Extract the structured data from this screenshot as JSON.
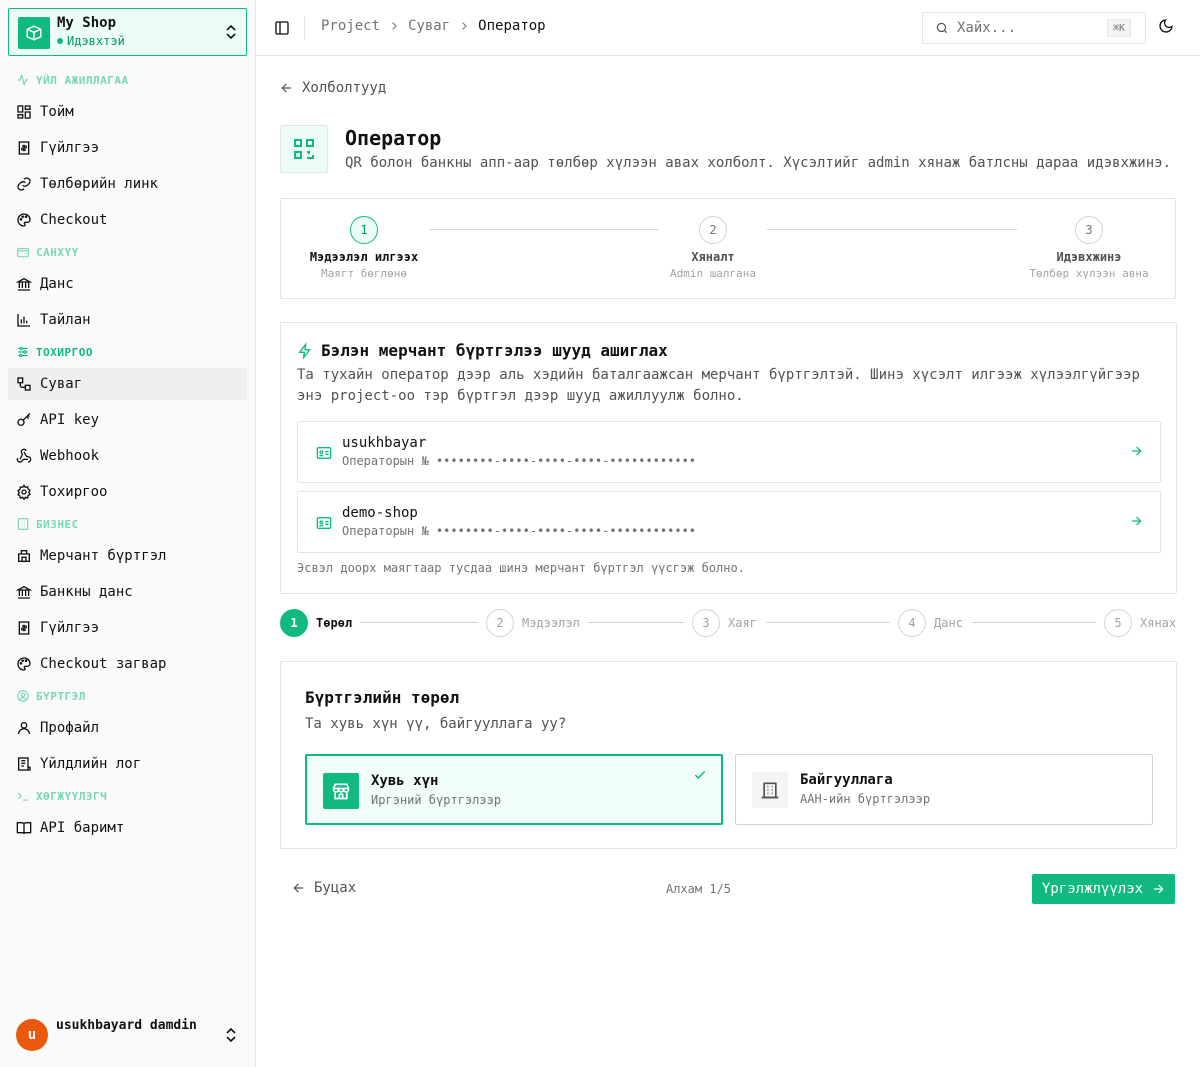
{
  "shop": {
    "name": "My Shop",
    "status": "Идэвхтэй"
  },
  "sidebar": {
    "sections": [
      {
        "label": "ҮЙЛ АЖИЛЛАГАА",
        "icon": "activity-icon",
        "items": [
          {
            "label": "Тойм",
            "icon": "dashboard-icon"
          },
          {
            "label": "Гүйлгээ",
            "icon": "receipt-icon"
          },
          {
            "label": "Төлбөрийн линк",
            "icon": "link-icon"
          },
          {
            "label": "Checkout",
            "icon": "palette-icon"
          }
        ]
      },
      {
        "label": "САНХҮҮ",
        "icon": "wallet-icon",
        "items": [
          {
            "label": "Данс",
            "icon": "bank-icon"
          },
          {
            "label": "Тайлан",
            "icon": "chart-icon"
          }
        ]
      },
      {
        "label": "ТОХИРГОО",
        "icon": "sliders-icon",
        "items": [
          {
            "label": "Суваг",
            "icon": "channel-icon"
          },
          {
            "label": "API key",
            "icon": "key-icon"
          },
          {
            "label": "Webhook",
            "icon": "webhook-icon"
          },
          {
            "label": "Тохиргоо",
            "icon": "gear-icon"
          }
        ]
      },
      {
        "label": "БИЗНЕС",
        "icon": "building-icon",
        "items": [
          {
            "label": "Мерчант бүртгэл",
            "icon": "store-icon"
          },
          {
            "label": "Банкны данс",
            "icon": "bank-icon"
          },
          {
            "label": "Гүйлгээ",
            "icon": "receipt-icon"
          },
          {
            "label": "Checkout загвар",
            "icon": "palette-icon"
          }
        ]
      },
      {
        "label": "БҮРТГЭЛ",
        "icon": "user-circle-icon",
        "items": [
          {
            "label": "Профайл",
            "icon": "user-icon"
          },
          {
            "label": "Үйлдлийн лог",
            "icon": "log-icon"
          }
        ]
      },
      {
        "label": "ХӨГЖҮҮЛЭГЧ",
        "icon": "terminal-icon",
        "items": [
          {
            "label": "API баримт",
            "icon": "book-icon"
          }
        ]
      }
    ]
  },
  "user": {
    "initial": "u",
    "name": "usukhbayard damdin"
  },
  "topbar": {
    "breadcrumbs": [
      "Project",
      "Суваг",
      "Оператор"
    ],
    "search_placeholder": "Хайх...",
    "shortcut": "⌘K"
  },
  "page": {
    "back_label": "Холболтууд",
    "title": "Оператор",
    "description": "QR болон банкны апп-аар төлбөр хүлээн авах холболт. Хүсэлтийг admin хянаж батлсны дараа идэвхжинэ."
  },
  "process_steps": [
    {
      "num": "1",
      "label": "Мэдээлэл илгээх",
      "sub": "Маягт бөглөнө"
    },
    {
      "num": "2",
      "label": "Хяналт",
      "sub": "Admin шалгана"
    },
    {
      "num": "3",
      "label": "Идэвхжинэ",
      "sub": "Төлбөр хүлээн авна"
    }
  ],
  "merchant_section": {
    "title": "Бэлэн мерчант бүртгэлээ шууд ашиглах",
    "description": "Та тухайн оператор дээр аль хэдийн баталгаажсан мерчант бүртгэлтэй. Шинэ хүсэлт илгээж хүлээлгүйгээр энэ project-оо тэр бүртгэл дээр шууд ажиллуулж болно.",
    "merchants": [
      {
        "name": "usukhbayar",
        "operator_label": "Операторын №",
        "operator_no": "••••••••-••••-••••-••••-••••••••••••"
      },
      {
        "name": "demo-shop",
        "operator_label": "Операторын №",
        "operator_no": "••••••••-••••-••••-••••-••••••••••••"
      }
    ],
    "footer": "Эсвэл доорх маягтаар тусдаа шинэ мерчант бүртгэл үүсгэж болно."
  },
  "wizard_steps": [
    {
      "num": "1",
      "label": "Төрөл"
    },
    {
      "num": "2",
      "label": "Мэдээлэл"
    },
    {
      "num": "3",
      "label": "Хаяг"
    },
    {
      "num": "4",
      "label": "Данс"
    },
    {
      "num": "5",
      "label": "Хянах"
    }
  ],
  "registration": {
    "title": "Бүртгэлийн төрөл",
    "question": "Та хувь хүн үү, байгууллага уу?",
    "options": [
      {
        "title": "Хувь хүн",
        "subtitle": "Иргэний бүртгэлээр",
        "selected": true
      },
      {
        "title": "Байгууллага",
        "subtitle": "ААН-ийн бүртгэлээр",
        "selected": false
      }
    ]
  },
  "footer": {
    "back_label": "Буцах",
    "step_indicator": "Алхам 1/5",
    "next_label": "Үргэлжлүүлэх"
  },
  "colors": {
    "accent": "#10b981",
    "accent_light": "#ecfdf5",
    "avatar": "#ea580c"
  }
}
